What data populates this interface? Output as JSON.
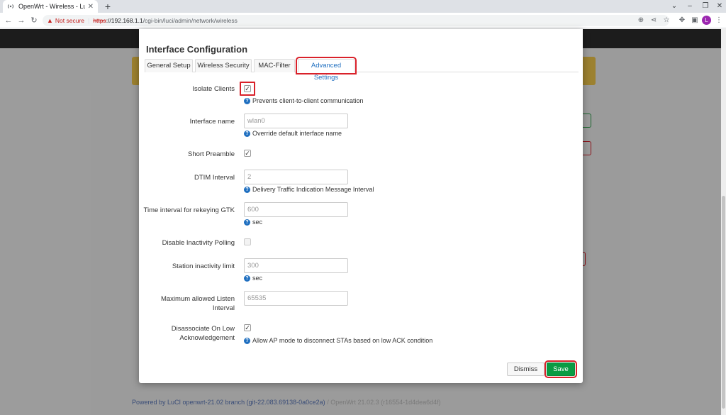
{
  "browser": {
    "tab_title": "OpenWrt - Wireless - LuCI",
    "tab_close": "✕",
    "new_tab": "+",
    "not_secure": "Not secure",
    "url_scheme": "https",
    "url_sep": "://",
    "url_host": "192.168.1.1",
    "url_path": "/cgi-bin/luci/admin/network/wireless",
    "profile_initial": "L"
  },
  "background": {
    "footer_link": "Powered by LuCI openwrt-21.02 branch (git-22.083.69138-0a0ce2a)",
    "footer_version": "/ OpenWrt 21.02.3 (r16554-1d4dea6d4f)"
  },
  "modal": {
    "title": "Interface Configuration",
    "tabs": [
      {
        "label": "General Setup"
      },
      {
        "label": "Wireless Security"
      },
      {
        "label": "MAC-Filter"
      },
      {
        "label": "Advanced Settings"
      }
    ],
    "isolate_clients": {
      "label": "Isolate Clients",
      "hint": "Prevents client-to-client communication",
      "checked": true
    },
    "interface_name": {
      "label": "Interface name",
      "placeholder": "wlan0",
      "hint": "Override default interface name"
    },
    "short_preamble": {
      "label": "Short Preamble",
      "checked": true
    },
    "dtim_interval": {
      "label": "DTIM Interval",
      "placeholder": "2",
      "hint": "Delivery Traffic Indication Message Interval"
    },
    "rekey_gtk": {
      "label": "Time interval for rekeying GTK",
      "placeholder": "600",
      "hint": "sec"
    },
    "disable_polling": {
      "label": "Disable Inactivity Polling",
      "checked": false
    },
    "station_inactivity": {
      "label": "Station inactivity limit",
      "placeholder": "300",
      "hint": "sec"
    },
    "max_listen_line1": "Maximum allowed Listen",
    "max_listen_line2": "Interval",
    "max_listen": {
      "placeholder": "65535"
    },
    "disassoc_line1": "Disassociate On Low",
    "disassoc_line2": "Acknowledgement",
    "disassoc": {
      "hint": "Allow AP mode to disconnect STAs based on low ACK condition",
      "checked": true
    },
    "dismiss_label": "Dismiss",
    "save_label": "Save"
  },
  "colors": {
    "save_green": "#0a9b43",
    "highlight_red": "#d9212a",
    "link_blue": "#1f6fc0"
  }
}
